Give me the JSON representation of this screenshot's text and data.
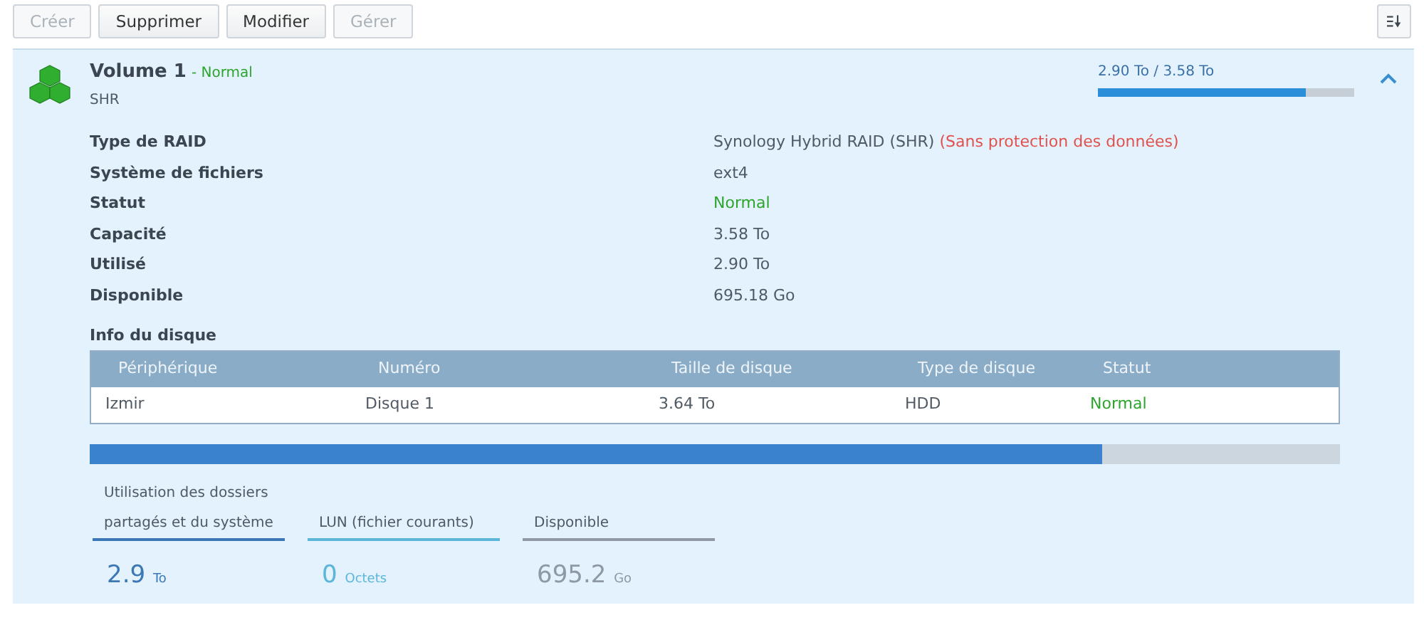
{
  "toolbar": {
    "buttons": [
      {
        "label": "Créer",
        "disabled": true
      },
      {
        "label": "Supprimer",
        "disabled": false
      },
      {
        "label": "Modifier",
        "disabled": false
      },
      {
        "label": "Gérer",
        "disabled": true
      }
    ]
  },
  "volume": {
    "title": "Volume 1",
    "separator": "-",
    "status": "Normal",
    "subtitle": "SHR",
    "usage_text": "2.90 To / 3.58 To",
    "level": 0.81,
    "expanded": true
  },
  "properties": [
    {
      "label": "Type de RAID",
      "value": "Synology Hybrid RAID (SHR)",
      "warning": "(Sans protection des données)",
      "kind": "text"
    },
    {
      "label": "Système de fichiers",
      "value": "ext4",
      "kind": "text"
    },
    {
      "label": "Statut",
      "value": "Normal",
      "kind": "status"
    },
    {
      "label": "Capacité",
      "value": "3.58 To",
      "kind": "text"
    },
    {
      "label": "Utilisé",
      "value": "2.90 To",
      "kind": "text"
    },
    {
      "label": "Disponible",
      "value": "695.18 Go",
      "kind": "text"
    }
  ],
  "disk_info": {
    "title": "Info du disque",
    "columns": [
      "Périphérique",
      "Numéro",
      "Taille de disque",
      "Type de disque",
      "Statut"
    ],
    "rows": [
      {
        "device": "Izmir",
        "number": "Disque 1",
        "size": "3.64 To",
        "type": "HDD",
        "status": "Normal"
      }
    ]
  },
  "usage_bar": {
    "level": 0.81
  },
  "legend": [
    {
      "label": "Utilisation des dossiers partagés et du système",
      "value": "2.9",
      "unit": "To",
      "color": "#3b78b5"
    },
    {
      "label": "LUN (fichier courants)",
      "value": "0",
      "unit": "Octets",
      "color": "#5cb6da"
    },
    {
      "label": "Disponible",
      "value": "695.2",
      "unit": "Go",
      "color": "#8e99a3"
    }
  ]
}
